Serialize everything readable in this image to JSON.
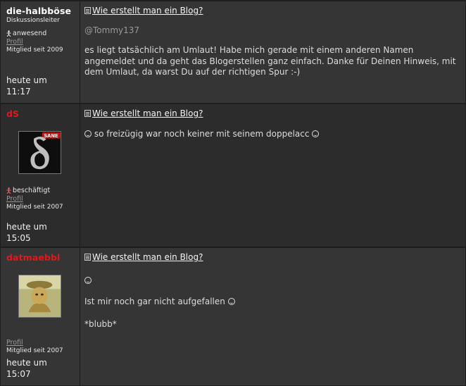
{
  "posts": [
    {
      "username": "die-halbböse",
      "role": "Diskussionsleiter",
      "status": "anwesend",
      "profile_link": "Profil",
      "member_since": "Mitglied seit 2009",
      "date": "heute um",
      "time": "11:17",
      "subject": "Wie erstellt man ein Blog?",
      "mention": "@Tommy137",
      "body": "es liegt tatsächlich am Umlaut! Habe mich gerade mit einem anderen Namen angemeldet und da geht das Blogerstellen ganz einfach. Danke für Deinen Hinweis, mit dem Umlaut, da warst Du auf der richtigen Spur :-)"
    },
    {
      "username": "dS",
      "avatar_badge": "SANE",
      "status": "beschäftigt",
      "profile_link": "Profil",
      "member_since": "Mitglied seit 2007",
      "date": "heute um",
      "time": "15:05",
      "subject": "Wie erstellt man ein Blog?",
      "body": "so freizügig war noch keiner mit seinem doppelacc"
    },
    {
      "username": "datmaebbl",
      "profile_link": "Profil",
      "member_since": "Mitglied seit 2007",
      "date": "heute um",
      "time": "15:07",
      "subject": "Wie erstellt man ein Blog?",
      "line2": "Ist mir noch gar nicht aufgefallen",
      "line3": "*blubb*"
    }
  ],
  "colors": {
    "username_red": "#e0181a",
    "post_bg": "#353535",
    "post_bg_alt": "#2c2c2c",
    "border": "#1e1e1e"
  },
  "icons": [
    "document-icon",
    "person-icon",
    "smiley-icon"
  ]
}
